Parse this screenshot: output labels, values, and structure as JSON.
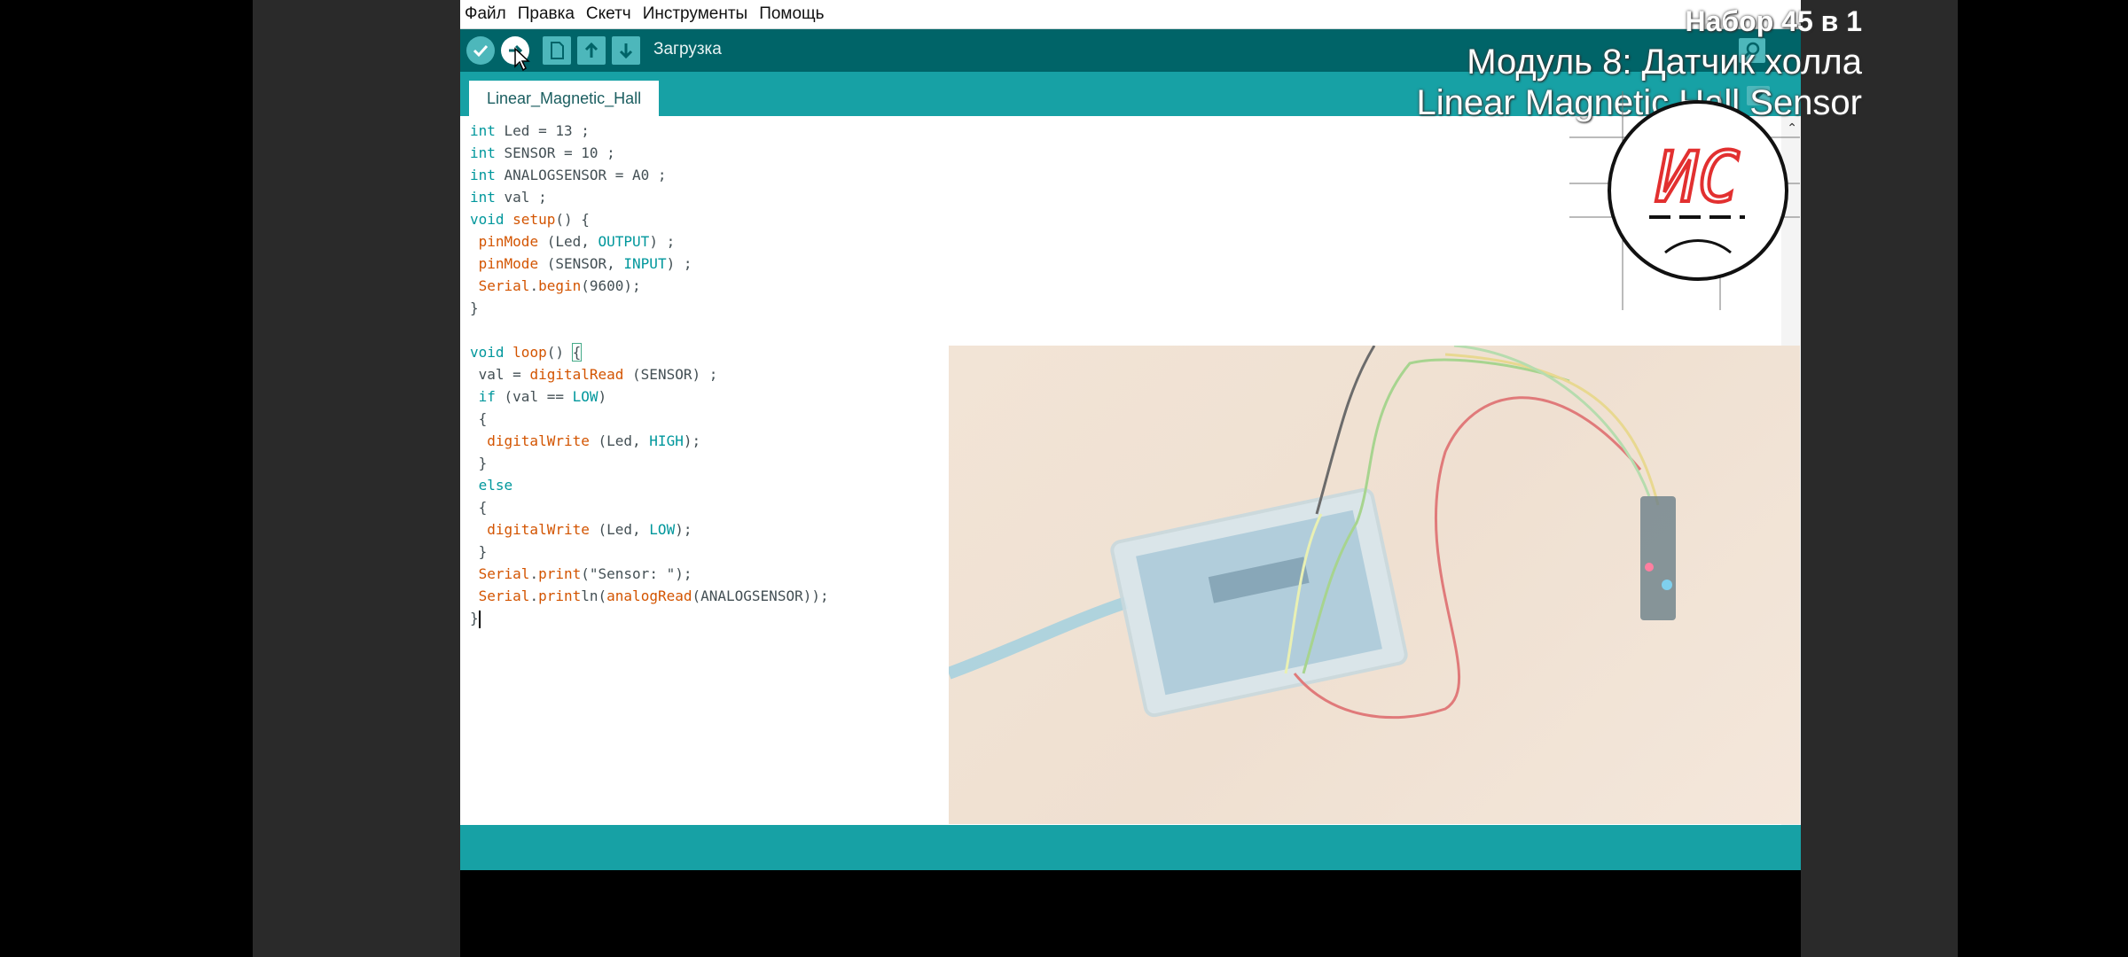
{
  "menu": [
    "Файл",
    "Правка",
    "Скетч",
    "Инструменты",
    "Помощь"
  ],
  "toolbar": {
    "status": "Загрузка"
  },
  "tab": {
    "name": "Linear_Magnetic_Hall"
  },
  "overlay": {
    "line1": "Набор 45 в 1",
    "line2": "Модуль 8: Датчик холла",
    "line3": "Linear Magnetic Hall Sensor"
  },
  "logo": {
    "text": "ИС"
  },
  "code": [
    "int Led = 13 ;",
    "int SENSOR = 10 ;",
    "int ANALOGSENSOR = A0 ;",
    "int val ;",
    "void setup() {",
    " pinMode (Led, OUTPUT) ;",
    " pinMode (SENSOR, INPUT) ;",
    " Serial.begin(9600);",
    "}",
    "",
    "void loop() {",
    " val = digitalRead (SENSOR) ;",
    " if (val == LOW)",
    " {",
    "  digitalWrite (Led, HIGH);",
    " }",
    " else",
    " {",
    "  digitalWrite (Led, LOW);",
    " }",
    " Serial.print(\"Sensor: \");",
    " Serial.println(analogRead(ANALOGSENSOR));",
    "}"
  ],
  "colors": {
    "toolbar": "#006468",
    "accent": "#17a1a5",
    "button": "#4db7bb"
  }
}
